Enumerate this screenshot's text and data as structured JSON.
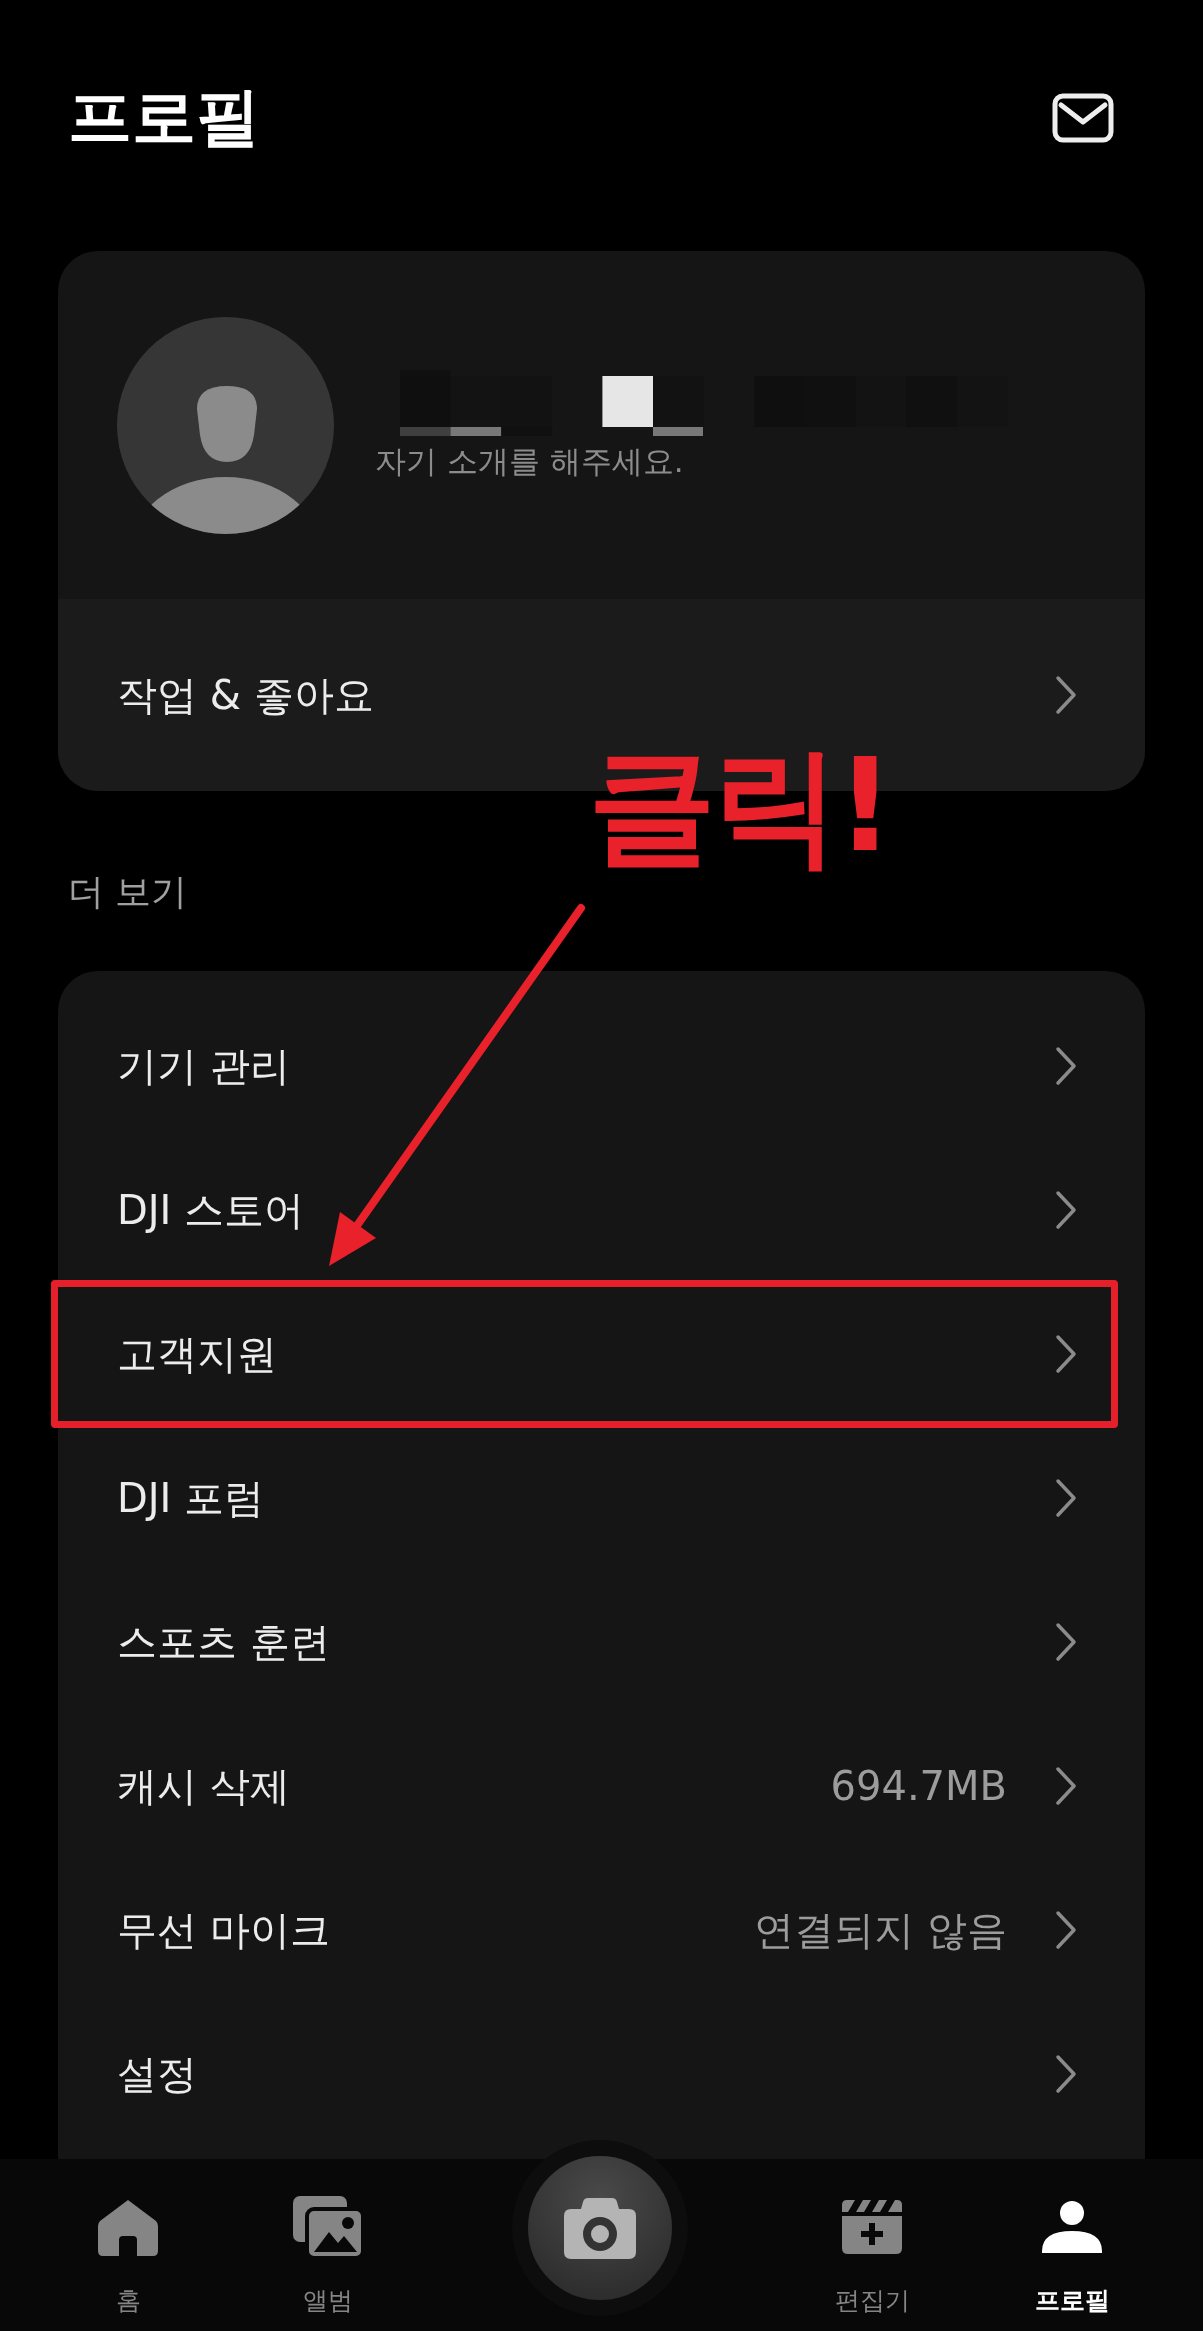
{
  "header": {
    "title": "프로필"
  },
  "profile": {
    "bio": "자기 소개를 해주세요.",
    "link_label": "작업 & 좋아요"
  },
  "section_title": "더 보기",
  "menu": [
    {
      "label": "기기 관리",
      "highlighted": false
    },
    {
      "label": "DJI 스토어",
      "highlighted": false
    },
    {
      "label": "고객지원",
      "highlighted": true
    },
    {
      "label": "DJI 포럼",
      "highlighted": false
    },
    {
      "label": "스포츠 훈련",
      "highlighted": false
    },
    {
      "label": "캐시 삭제",
      "value": "694.7MB",
      "highlighted": false
    },
    {
      "label": "무선 마이크",
      "value": "연결되지 않음",
      "highlighted": false
    },
    {
      "label": "설정",
      "highlighted": false
    }
  ],
  "annotation": {
    "text": "클릭!"
  },
  "bottom_nav": {
    "tabs": [
      {
        "label": "홈",
        "selected": false
      },
      {
        "label": "앨범",
        "selected": false
      },
      {
        "label": "편집기",
        "selected": false
      },
      {
        "label": "프로필",
        "selected": true
      }
    ]
  }
}
